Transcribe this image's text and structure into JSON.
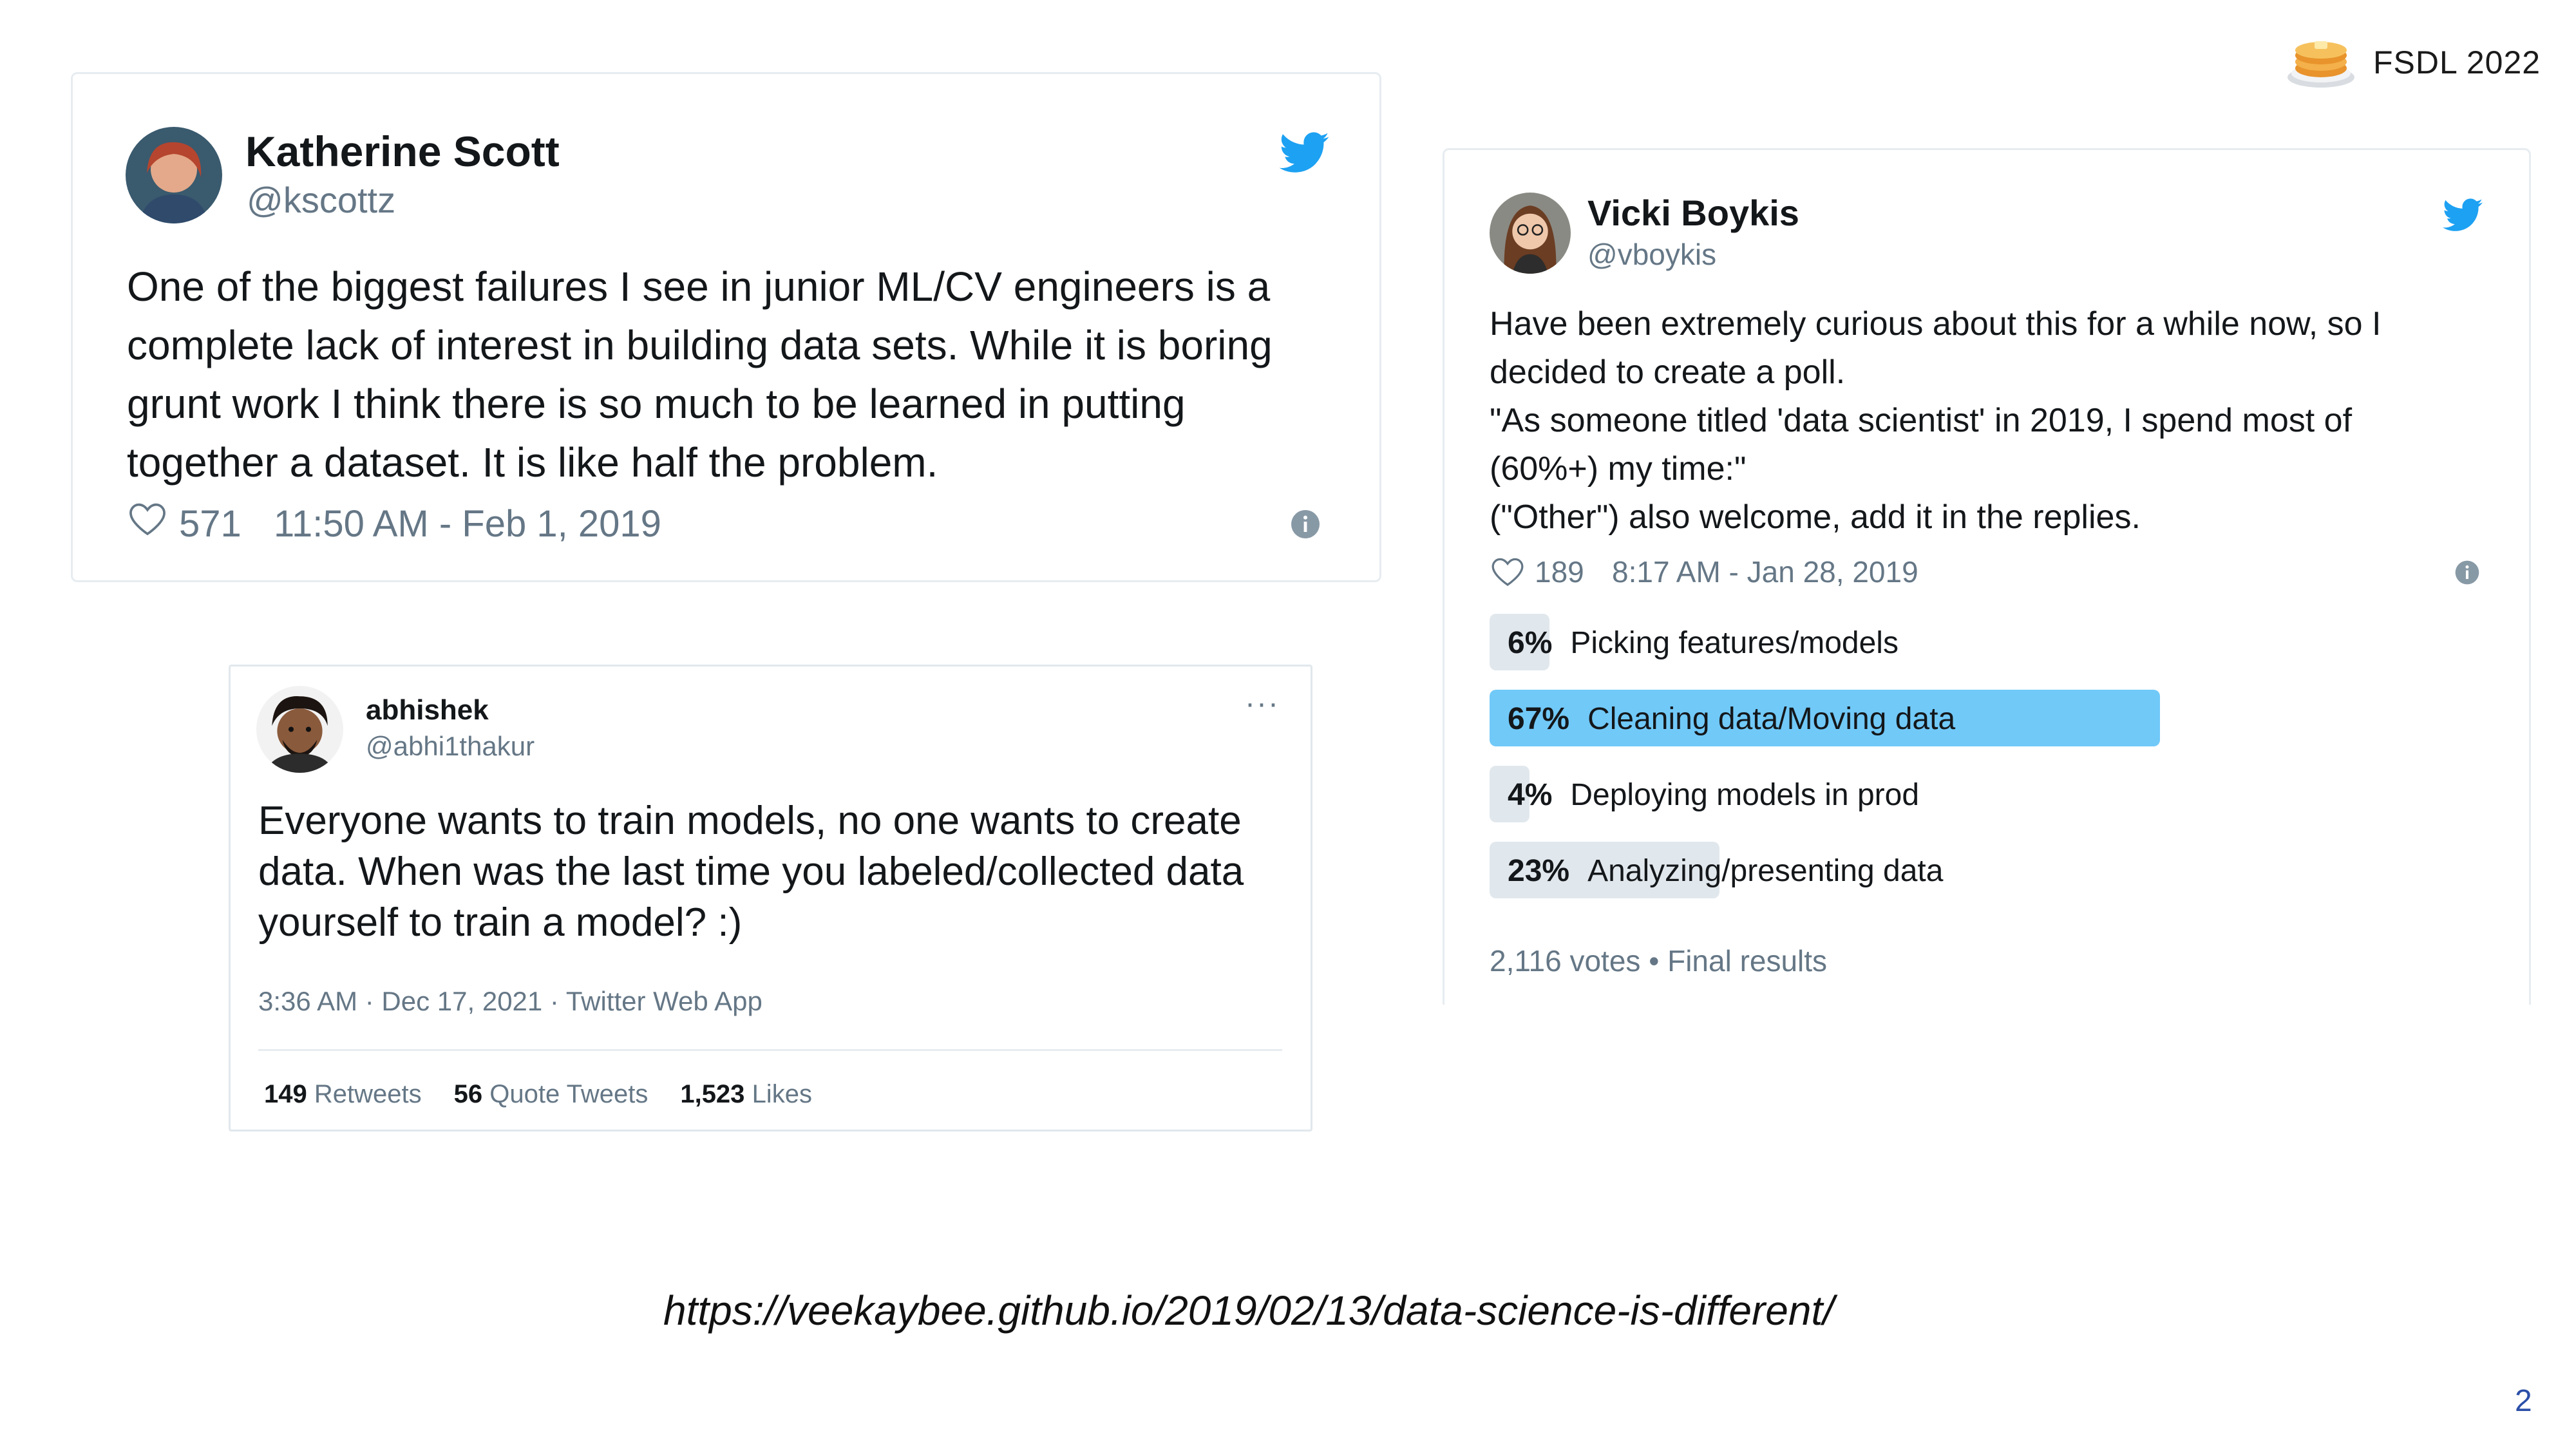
{
  "slide": {
    "badge_label": "FSDL 2022",
    "source_url": "https://veekaybee.github.io/2019/02/13/data-science-is-different/",
    "page_number": "2"
  },
  "tweet1": {
    "name": "Katherine Scott",
    "handle": "@kscottz",
    "text": "One of the biggest failures I see in junior ML/CV engineers is a complete lack of interest in building data sets. While it is boring grunt work I think there is so much to be learned in putting together a dataset. It is like half the problem.",
    "likes": "571",
    "timestamp": "11:50 AM - Feb 1, 2019"
  },
  "tweet2": {
    "name": "abhishek",
    "handle": "@abhi1thakur",
    "more": "···",
    "text": "Everyone wants to train models, no one wants to create data. When was the last time you labeled/collected data yourself to train a model? :)",
    "meta": "3:36 AM · Dec 17, 2021 · Twitter Web App",
    "retweets_count": "149",
    "retweets_label": "Retweets",
    "quotes_count": "56",
    "quotes_label": "Quote Tweets",
    "likes_count": "1,523",
    "likes_label": "Likes"
  },
  "tweet3": {
    "name": "Vicki Boykis",
    "handle": "@vboykis",
    "text_lines": [
      "Have been extremely curious about this for a while now, so I",
      "decided to create a poll.",
      "\"As someone titled 'data scientist' in 2019, I spend most of",
      "(60%+)  my time:\"",
      "(\"Other\") also welcome, add it in the replies."
    ],
    "likes": "189",
    "timestamp": "8:17 AM - Jan 28, 2019",
    "poll": [
      {
        "percent": "6%",
        "label": "Picking features/models",
        "value": 6
      },
      {
        "percent": "67%",
        "label": "Cleaning data/Moving data",
        "value": 67
      },
      {
        "percent": "4%",
        "label": "Deploying models in prod",
        "value": 4
      },
      {
        "percent": "23%",
        "label": "Analyzing/presenting data",
        "value": 23
      }
    ],
    "votes": "2,116 votes • Final results"
  },
  "colors": {
    "twitter_blue": "#1da1f2",
    "poll_winner": "#71c9f8",
    "poll_bar": "#e1e8ed",
    "muted_text": "#657786",
    "page_number": "#2b4fa8"
  },
  "icons": [
    "twitter-bird-icon",
    "heart-icon",
    "info-icon",
    "more-options-icon",
    "pancake-logo-icon"
  ]
}
